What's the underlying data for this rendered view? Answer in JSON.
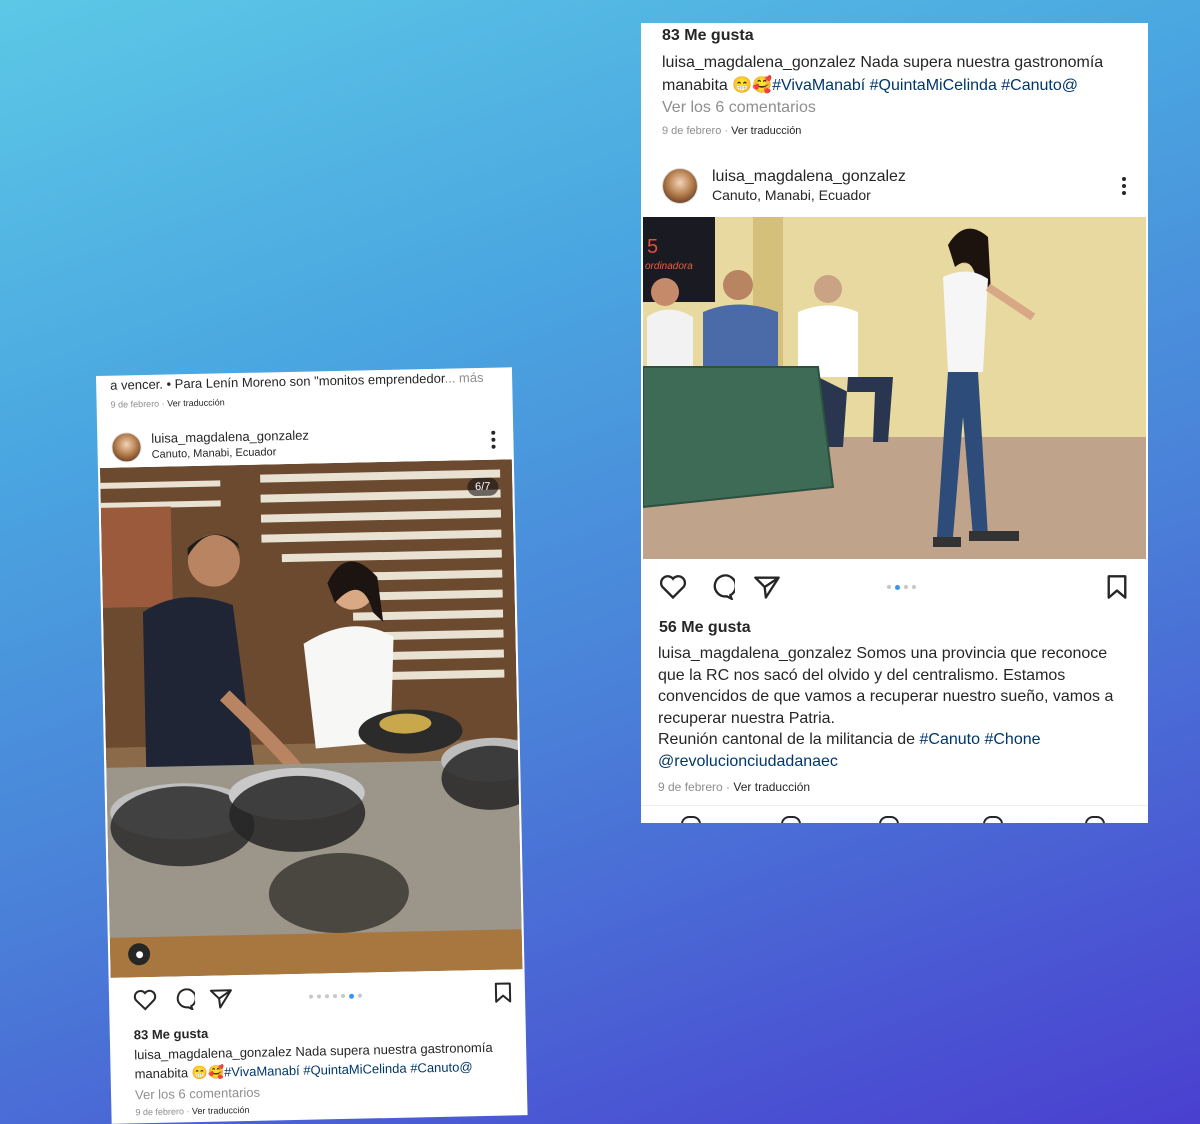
{
  "left_post": {
    "prev_caption": "a vencer. • Para Lenín Moreno son \"monitos emprendedor",
    "prev_more": "... más",
    "prev_date": "9 de febrero",
    "prev_translate": "Ver traducción",
    "username": "luisa_magdalena_gonzalez",
    "location": "Canuto, Manabi, Ecuador",
    "counter": "6/7",
    "likes": "83 Me gusta",
    "caption_user": "luisa_magdalena_gonzalez",
    "caption_text": "Nada supera nuestra gastronomía manabita 😁🥰",
    "hashtags": "#VivaManabí #QuintaMiCelinda #Canuto@",
    "view_comments": "Ver los 6 comentarios",
    "date": "9 de febrero",
    "translate": "Ver traducción",
    "carousel": {
      "total": 7,
      "active": 6
    }
  },
  "right_post": {
    "prev_likes": "83 Me gusta",
    "prev_caption_user": "luisa_magdalena_gonzalez",
    "prev_caption_text": "Nada supera nuestra gastronomía manabita 😁🥰",
    "prev_hashtags": "#VivaManabí #QuintaMiCelinda #Canuto@",
    "prev_view_comments": "Ver los 6 comentarios",
    "prev_date": "9 de febrero",
    "prev_translate": "Ver traducción",
    "username": "luisa_magdalena_gonzalez",
    "location": "Canuto, Manabi, Ecuador",
    "banner_text_1": "5",
    "banner_text_2": "ordinadora",
    "likes": "56 Me gusta",
    "caption_user": "luisa_magdalena_gonzalez",
    "caption_text": "Somos una provincia que reconoce que la RC nos sacó del olvido y del centralismo. Estamos convencidos de que vamos a recuperar nuestro sueño, vamos a recuperar nuestra Patria.",
    "caption_line2": "Reunión cantonal de la militancia de",
    "hashtag_1": "#Canuto",
    "hashtag_2": "#Chone",
    "mention": "@revolucionciudadanaec",
    "date": "9 de febrero",
    "translate": "Ver traducción",
    "carousel": {
      "total": 4,
      "active": 2
    }
  },
  "colors": {
    "hashtag": "#00376b",
    "muted": "#8e8e8e",
    "carousel_active": "#3797f0",
    "bg_top": "#5cc8e6",
    "bg_bottom": "#4a3fd0"
  }
}
